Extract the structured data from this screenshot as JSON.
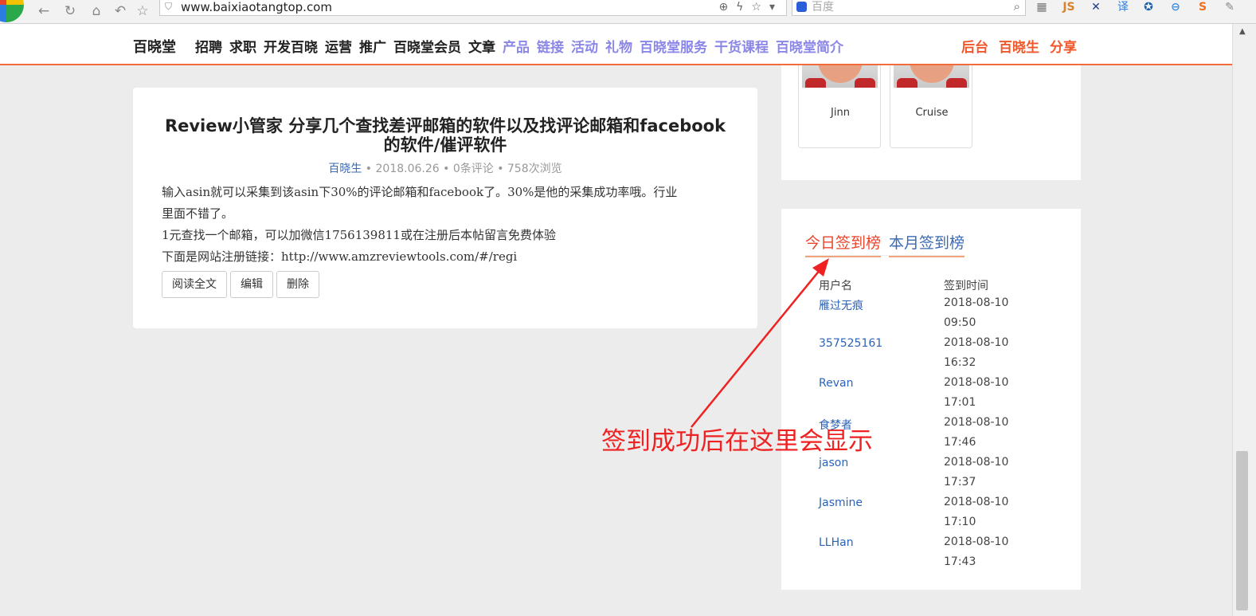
{
  "browser": {
    "url": "www.baixiaotangtop.com",
    "search_placeholder": "百度",
    "extensions": [
      "JS",
      "译"
    ]
  },
  "header": {
    "brand": "百晓堂",
    "menu": [
      "招聘",
      "求职",
      "开发百晓",
      "运营",
      "推广",
      "百晓堂会员",
      "文章"
    ],
    "menu_blue": [
      "产品",
      "链接",
      "活动",
      "礼物",
      "百晓堂服务",
      "干货课程",
      "百晓堂简介"
    ],
    "menu_right": [
      "后台",
      "百晓生",
      "分享"
    ]
  },
  "post": {
    "title": "Review小管家 分享几个查找差评邮箱的软件以及找评论邮箱和facebook的软件/催评软件",
    "author": "百晓生",
    "meta_rest": " • 2018.06.26 • 0条评论 • 758次浏览",
    "excerpt_lines": [
      "输入asin就可以采集到该asin下30%的评论邮箱和facebook了。30%是他的采集成功率哦。行业",
      "里面不错了。",
      "1元查找一个邮箱，可以加微信1756139811或在注册后本帖留言免费体验",
      "下面是网站注册链接：http://www.amzreviewtools.com/#/regi"
    ],
    "buttons": {
      "read": "阅读全文",
      "edit": "编辑",
      "delete": "删除"
    }
  },
  "members": [
    {
      "name": "Jinn"
    },
    {
      "name": "Cruise"
    }
  ],
  "checkin": {
    "tabs": {
      "today": "今日签到榜",
      "month": "本月签到榜"
    },
    "headers": {
      "user": "用户名",
      "time": "签到时间"
    },
    "rows": [
      {
        "user": "雁过无痕",
        "date": "2018-08-10",
        "time": "09:50"
      },
      {
        "user": "357525161",
        "date": "2018-08-10",
        "time": "16:32"
      },
      {
        "user": "Revan",
        "date": "2018-08-10",
        "time": "17:01"
      },
      {
        "user": "食梦者",
        "date": "2018-08-10",
        "time": "17:46"
      },
      {
        "user": "jason",
        "date": "2018-08-10",
        "time": "17:37"
      },
      {
        "user": "Jasmine",
        "date": "2018-08-10",
        "time": "17:10"
      },
      {
        "user": "LLHan",
        "date": "2018-08-10",
        "time": "17:43"
      }
    ]
  },
  "annotation": {
    "text": "签到成功后在这里会显示",
    "color": "#ee2222"
  }
}
